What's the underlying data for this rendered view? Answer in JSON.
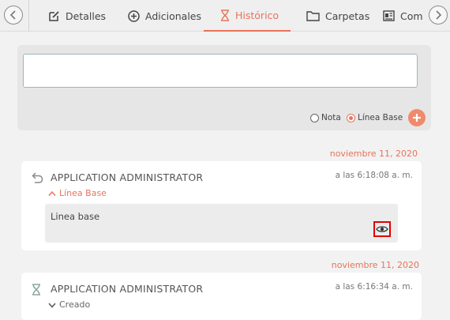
{
  "tabs": {
    "detalles": "Detalles",
    "adicionales": "Adicionales",
    "historico": "Histórico",
    "carpetas": "Carpetas",
    "comp": "Com"
  },
  "active_tab": "historico",
  "composer": {
    "value": "",
    "radio_nota": "Nota",
    "radio_linea": "Línea Base",
    "selected": "Línea Base"
  },
  "entries": [
    {
      "date": "noviembre 11, 2020",
      "user": "APPLICATION ADMINISTRATOR",
      "time": "a las 6:18:08 a. m.",
      "type": "Línea Base",
      "type_icon": "chevron-up-icon",
      "icon": "undo-icon",
      "body": "Linea base"
    },
    {
      "date": "noviembre 11, 2020",
      "user": "APPLICATION ADMINISTRATOR",
      "time": "a las 6:16:34 a. m.",
      "type": "Creado",
      "type_icon": "chevron-down-icon",
      "icon": "hourglass-icon"
    }
  ],
  "colors": {
    "accent": "#e8735a",
    "highlight": "#e00000"
  }
}
